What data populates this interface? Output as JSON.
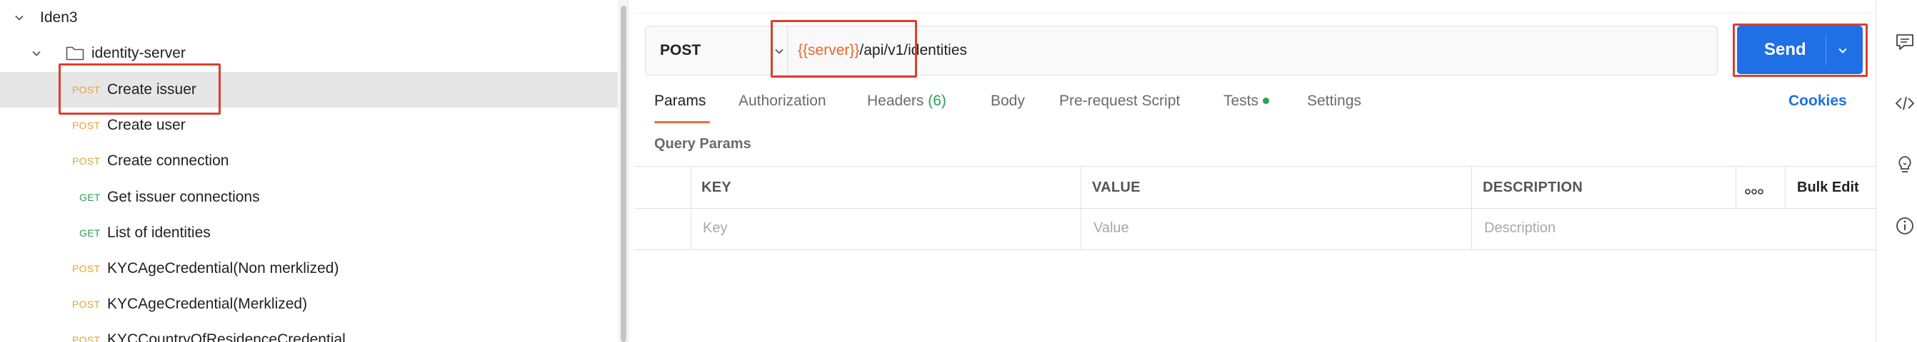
{
  "sidebar": {
    "collection": "Iden3",
    "folder": "identity-server",
    "requests": [
      {
        "method": "POST",
        "label": "Create issuer",
        "selected": true
      },
      {
        "method": "POST",
        "label": "Create user"
      },
      {
        "method": "POST",
        "label": "Create connection"
      },
      {
        "method": "GET",
        "label": "Get issuer connections"
      },
      {
        "method": "GET",
        "label": "List of identities"
      },
      {
        "method": "POST",
        "label": "KYCAgeCredential(Non merklized)"
      },
      {
        "method": "POST",
        "label": "KYCAgeCredential(Merklized)"
      },
      {
        "method": "POST",
        "label": "KYCCountryOfResidenceCredential"
      }
    ]
  },
  "request": {
    "method": "POST",
    "url_variable": "{{server}}",
    "url_path": "/api/v1/identities",
    "send_label": "Send"
  },
  "tabs": {
    "params": "Params",
    "authorization": "Authorization",
    "headers": "Headers",
    "headers_count": "(6)",
    "body": "Body",
    "pre_request": "Pre-request Script",
    "tests": "Tests",
    "settings": "Settings",
    "cookies": "Cookies",
    "active": "Params"
  },
  "query_params": {
    "title": "Query Params",
    "columns": [
      "KEY",
      "VALUE",
      "DESCRIPTION"
    ],
    "bulk_edit": "Bulk Edit",
    "placeholders": [
      "Key",
      "Value",
      "Description"
    ]
  },
  "colors": {
    "post": "#e5a33a",
    "get": "#2f9e57",
    "send": "#1f6fe5",
    "highlight": "#d9402f",
    "url_variable": "#e8662f"
  },
  "icons": [
    "chevron-down-icon",
    "folder-icon",
    "comment-icon",
    "code-icon",
    "lightbulb-icon",
    "info-icon",
    "more-horizontal-icon"
  ]
}
